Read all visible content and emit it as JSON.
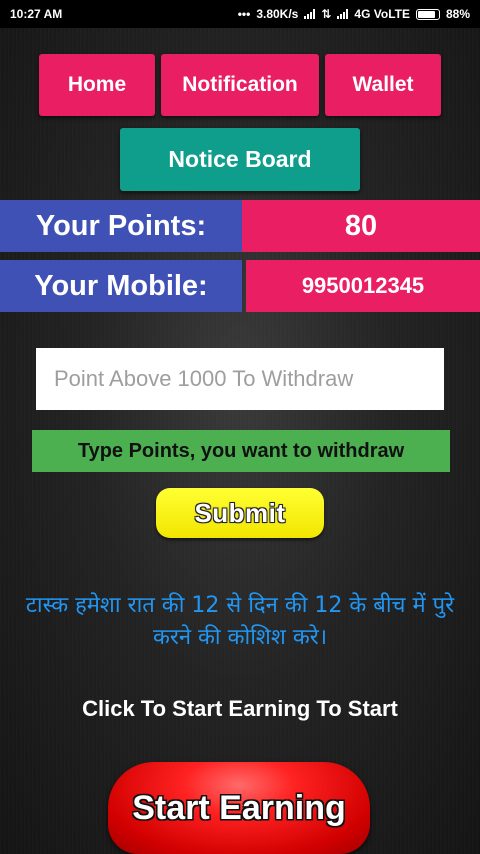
{
  "status_bar": {
    "time": "10:27 AM",
    "speed": "3.80K/s",
    "network": "4G VoLTE",
    "battery": "88%"
  },
  "nav": {
    "home": "Home",
    "notification": "Notification",
    "wallet": "Wallet",
    "notice_board": "Notice Board"
  },
  "info": {
    "points_label": "Your Points:",
    "points_value": "80",
    "mobile_label": "Your Mobile:",
    "mobile_value": "9950012345"
  },
  "withdraw": {
    "placeholder": "Point Above 1000 To Withdraw",
    "hint": "Type Points, you want to withdraw",
    "submit_label": "Submit"
  },
  "notice": {
    "text": "टास्क हमेशा रात की 12 से दिन की 12 के बीच में पुरे करने की कोशिश करे।"
  },
  "earning": {
    "prompt": "Click To Start Earning To Start",
    "button_label": "Start Earning"
  },
  "colors": {
    "pink": "#e91e63",
    "teal": "#0f9d8c",
    "blue": "#3f51b5",
    "green": "#4caf50",
    "yellow": "#ffff33",
    "red": "#f22222",
    "hindi_text": "#2196f3"
  }
}
